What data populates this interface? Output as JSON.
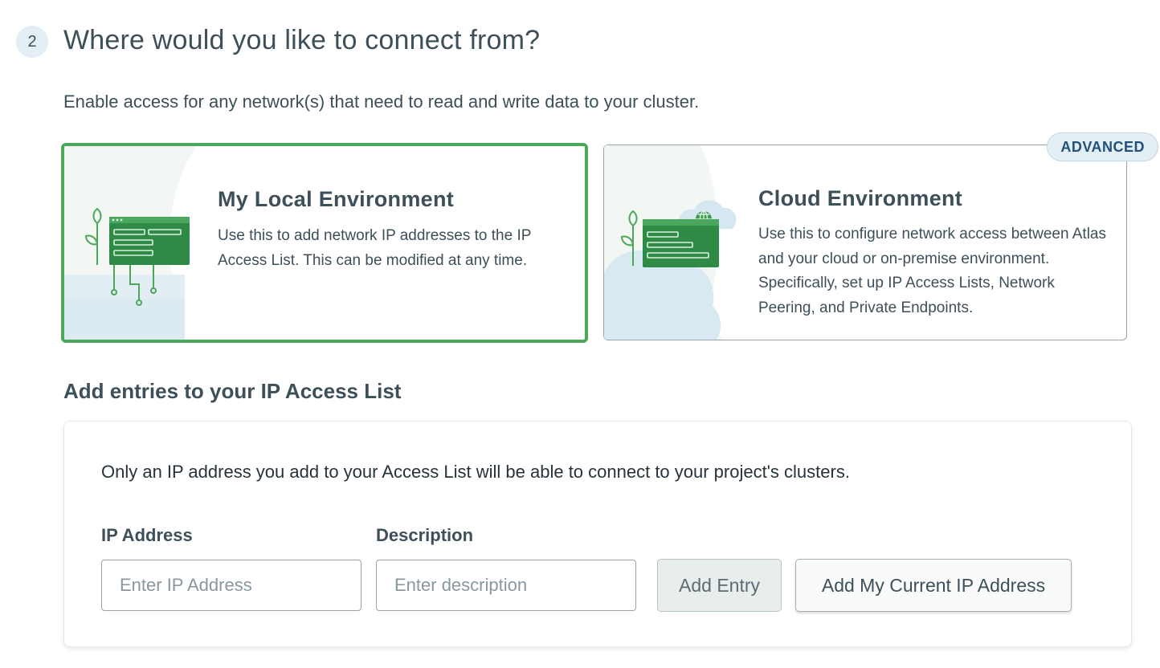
{
  "step": {
    "number": "2",
    "title": "Where would you like to connect from?",
    "intro": "Enable access for any network(s) that need to read and write data to your cluster."
  },
  "environments": [
    {
      "title": "My Local Environment",
      "description": "Use this to add network IP addresses to the IP Access List. This can be modified at any time.",
      "selected": true
    },
    {
      "title": "Cloud Environment",
      "description": "Use this to configure network access between Atlas and your cloud or on-premise environment. Specifically, set up IP Access Lists, Network Peering, and Private Endpoints.",
      "badge": "ADVANCED",
      "selected": false
    }
  ],
  "access_list": {
    "heading": "Add entries to your IP Access List",
    "note": "Only an IP address you add to your Access List will be able to connect to your project's clusters.",
    "ip_label": "IP Address",
    "ip_placeholder": "Enter IP Address",
    "desc_label": "Description",
    "desc_placeholder": "Enter description",
    "add_entry_label": "Add Entry",
    "add_current_ip_label": "Add My Current IP Address"
  },
  "colors": {
    "selected_border": "#4ca75a",
    "illustration_green": "#3d9a4e",
    "badge_bg": "#e3eef5",
    "badge_text": "#21507a"
  },
  "icons": {
    "local_illustration": "browser-window-with-circuit-icon",
    "cloud_illustration": "cloud-with-globe-icon"
  }
}
